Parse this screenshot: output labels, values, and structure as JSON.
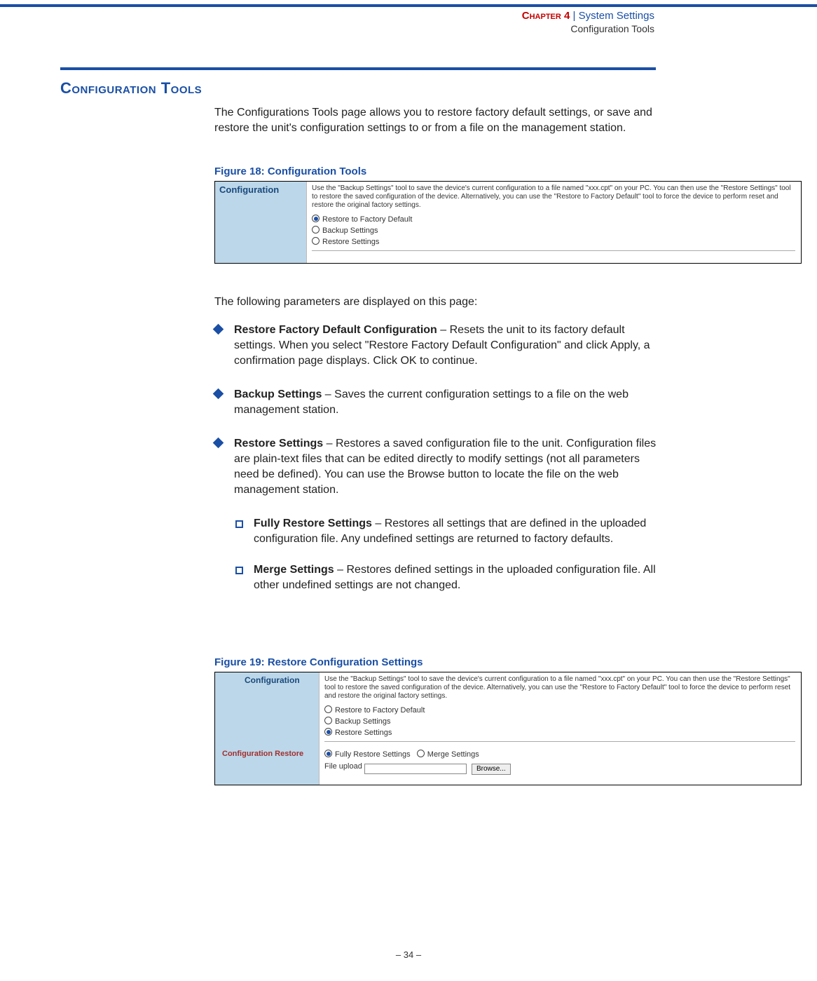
{
  "header": {
    "chapter_label": "Chapter 4",
    "pipe": "|",
    "title": "System Settings",
    "subtitle": "Configuration Tools"
  },
  "section": {
    "heading": "Configuration Tools",
    "intro": "The Configurations Tools page allows you to restore factory default settings, or save and restore the unit's configuration settings to or from a file on the management station.",
    "following": "The following parameters are displayed on this page:"
  },
  "figures": {
    "f18": {
      "caption": "Figure 18:  Configuration Tools",
      "left_label": "Configuration",
      "desc": "Use the \"Backup Settings\" tool to save the device's current configuration to a file named \"xxx.cpt\" on your PC. You can then use the \"Restore Settings\" tool to restore the saved configuration of the device. Alternatively, you can use the \"Restore to Factory Default\" tool to force the device to perform reset and restore the original factory settings.",
      "opts": {
        "o1": "Restore to Factory Default",
        "o2": "Backup Settings",
        "o3": "Restore Settings"
      }
    },
    "f19": {
      "caption": "Figure 19:  Restore Configuration Settings",
      "left_top": "Configuration",
      "left_mid": "Configuration Restore",
      "desc": "Use the \"Backup Settings\" tool to save the device's current configuration to a file named \"xxx.cpt\" on your PC. You can then use the \"Restore Settings\" tool to restore the saved configuration of the device. Alternatively, you can use the \"Restore to Factory Default\" tool to force the device to perform reset and restore the original factory settings.",
      "opts": {
        "o1": "Restore to Factory Default",
        "o2": "Backup Settings",
        "o3": "Restore Settings"
      },
      "row2": {
        "r1": "Fully Restore Settings",
        "r2": "Merge Settings"
      },
      "upload_label": "File upload",
      "browse": "Browse..."
    }
  },
  "bullets": {
    "b1": {
      "title": "Restore Factory Default Configuration",
      "sep": " – ",
      "text": "Resets the unit to its factory default settings. When you select \"Restore Factory Default Configuration\" and click Apply, a confirmation page displays. Click OK to continue."
    },
    "b2": {
      "title": "Backup Settings",
      "sep": " – ",
      "text": "Saves the current configuration settings to a file on the web management station."
    },
    "b3": {
      "title": "Restore Settings",
      "sep": " – ",
      "text": "Restores a saved configuration file to the unit. Configuration files are plain-text files that can be edited directly to modify settings (not all parameters need be defined). You can use the Browse button to locate the file on the web management station."
    },
    "s1": {
      "title": "Fully Restore Settings",
      "sep": " – ",
      "text": "Restores all settings that are defined in the uploaded configuration file. Any undefined settings are returned to factory defaults."
    },
    "s2": {
      "title": "Merge Settings",
      "sep": " – ",
      "text": "Restores defined settings in the uploaded configuration file. All other undefined settings are not changed."
    }
  },
  "footer": {
    "page": "–  34  –"
  }
}
